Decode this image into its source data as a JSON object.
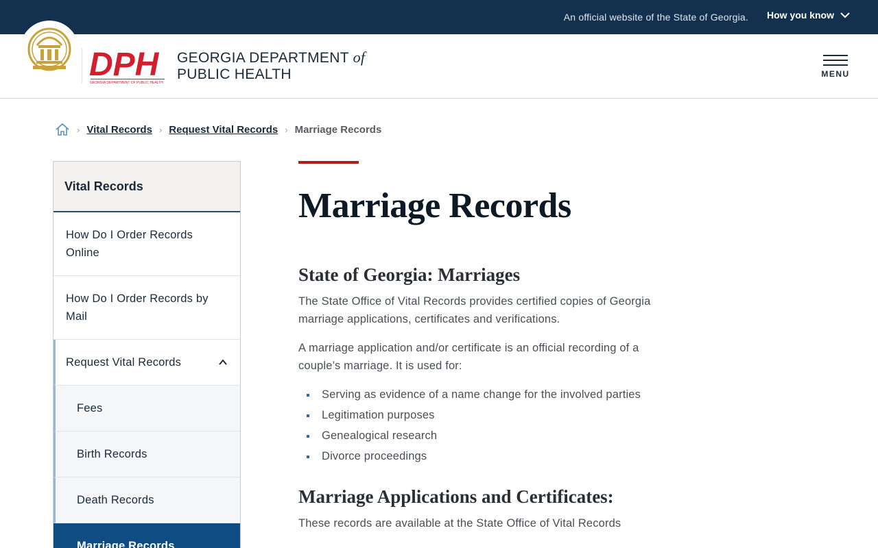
{
  "banner": {
    "official_text": "An official website of the State of Georgia.",
    "how_you_know": "How you know"
  },
  "header": {
    "dept_line1_prefix": "GEORGIA DEPARTMENT",
    "dept_line1_of": "of",
    "dept_line2": "PUBLIC HEALTH",
    "logo_text": "DPH",
    "logo_subtext": "GEORGIA DEPARTMENT OF PUBLIC HEALTH",
    "menu_label": "MENU"
  },
  "breadcrumb": {
    "items": [
      "Vital Records",
      "Request Vital Records"
    ],
    "current": "Marriage Records"
  },
  "sidebar": {
    "title": "Vital Records",
    "items": [
      {
        "label": "How Do I Order Records Online"
      },
      {
        "label": "How Do I Order Records by Mail"
      },
      {
        "label": "Request Vital Records",
        "expanded": true
      }
    ],
    "subitems": [
      {
        "label": "Fees"
      },
      {
        "label": "Birth Records"
      },
      {
        "label": "Death Records"
      },
      {
        "label": "Marriage Records",
        "active": true
      }
    ]
  },
  "main": {
    "title": "Marriage Records",
    "section1": {
      "heading": "State of Georgia: Marriages",
      "para1": "The State Office of Vital Records provides certified copies of Georgia marriage applications, certificates and verifications.",
      "para2": "A marriage application and/or certificate is an official recording of a couple’s marriage. It is used for:",
      "bullets": [
        "Serving as evidence of a name change for the involved parties",
        "Legitimation purposes",
        "Genealogical research",
        "Divorce proceedings"
      ]
    },
    "section2": {
      "heading": "Marriage Applications and Certificates:",
      "para1": "These records are available at the State Office of Vital Records"
    }
  },
  "colors": {
    "banner_bg": "#13304f",
    "accent_red": "#b31b1b",
    "active_nav": "#0f4c81",
    "seal_gold": "#c9a23a",
    "logo_red": "#d0202e"
  }
}
